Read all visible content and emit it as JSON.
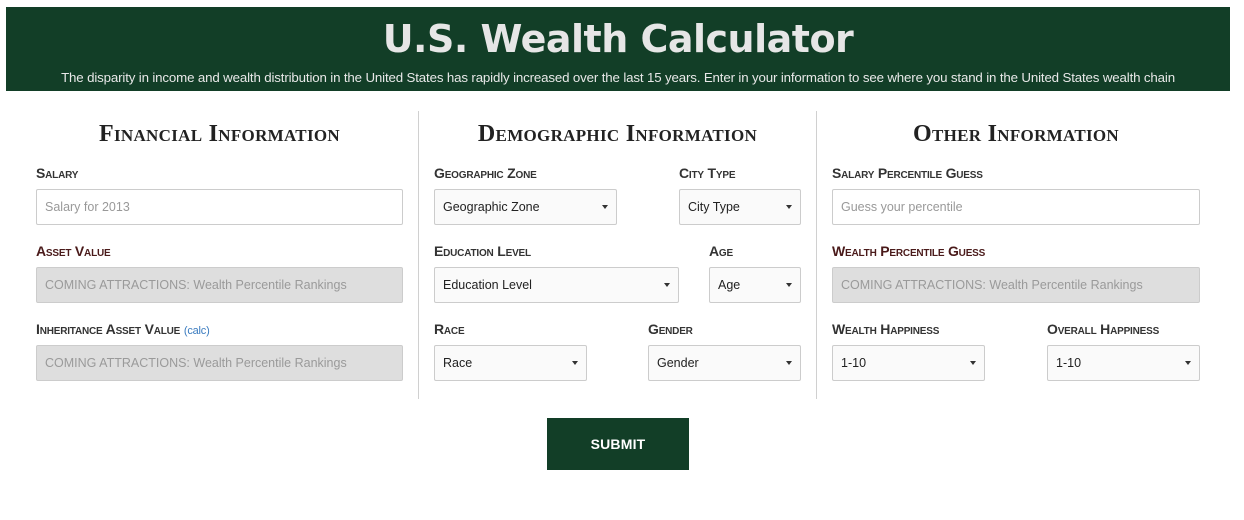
{
  "header": {
    "title": "U.S. Wealth Calculator",
    "subtitle": "The disparity in income and wealth distribution in the United States has rapidly increased over the last 15 years. Enter in your information to see where you stand in the United States wealth chain"
  },
  "financial": {
    "title": "Financial Information",
    "salary_label": "Salary",
    "salary_placeholder": "Salary for 2013",
    "asset_label": "Asset Value",
    "asset_value": "COMING ATTRACTIONS: Wealth Percentile Rankings",
    "inheritance_label": "Inheritance Asset Value",
    "calc_link": "(calc)",
    "inheritance_value": "COMING ATTRACTIONS: Wealth Percentile Rankings"
  },
  "demographic": {
    "title": "Demographic Information",
    "geo_label": "Geographic Zone",
    "geo_selected": "Geographic Zone",
    "city_label": "City Type",
    "city_selected": "City Type",
    "edu_label": "Education Level",
    "edu_selected": "Education Level",
    "age_label": "Age",
    "age_selected": "Age",
    "race_label": "Race",
    "race_selected": "Race",
    "gender_label": "Gender",
    "gender_selected": "Gender"
  },
  "other": {
    "title": "Other Information",
    "salary_guess_label": "Salary Percentile Guess",
    "salary_guess_placeholder": "Guess your percentile",
    "wealth_guess_label": "Wealth Percentile Guess",
    "wealth_guess_value": "COMING ATTRACTIONS: Wealth Percentile Rankings",
    "wealth_happiness_label": "Wealth Happiness",
    "wealth_happiness_selected": "1-10",
    "overall_happiness_label": "Overall Happiness",
    "overall_happiness_selected": "1-10"
  },
  "submit_label": "SUBMIT",
  "colors": {
    "brand": "#123e27",
    "disabled_bg": "#dedede"
  }
}
